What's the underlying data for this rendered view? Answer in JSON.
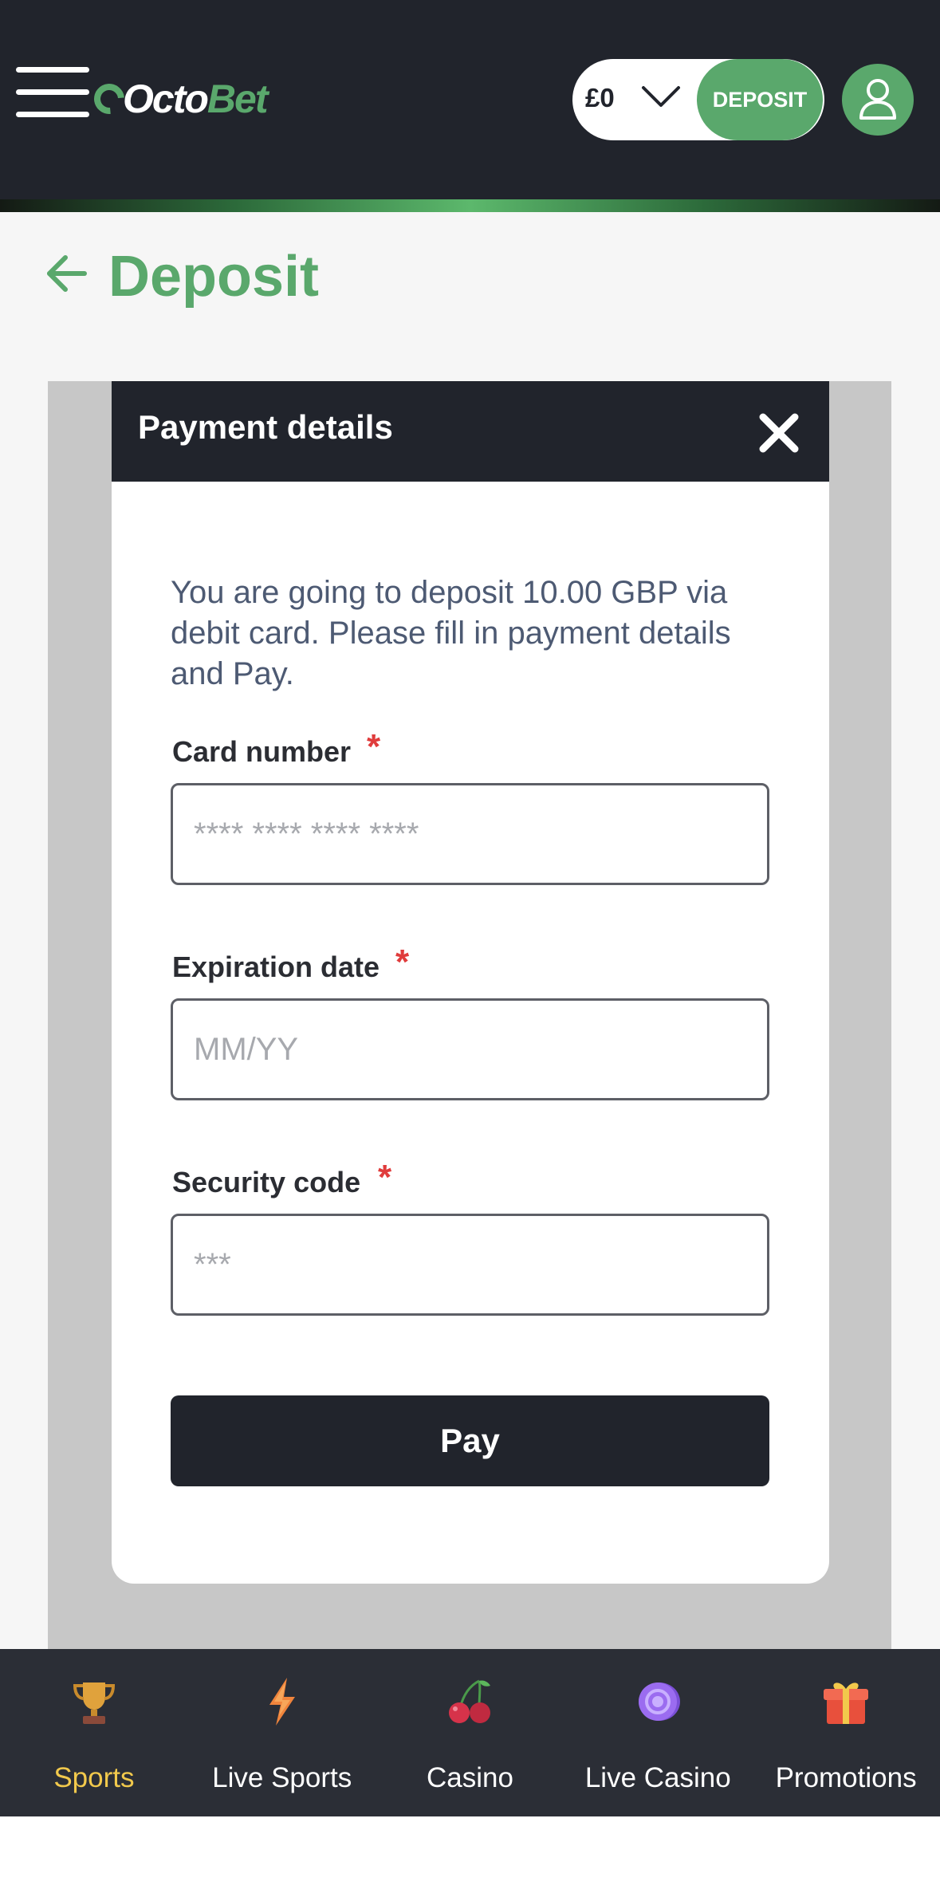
{
  "header": {
    "logo_prefix": "Octo",
    "logo_suffix": "Bet",
    "balance": "£0",
    "deposit_label": "DEPOSIT"
  },
  "page": {
    "title": "Deposit"
  },
  "modal": {
    "title": "Payment details",
    "intro": "You are going to deposit 10.00 GBP via debit card. Please fill in payment details and Pay.",
    "fields": {
      "card_number": {
        "label": "Card number",
        "required_mark": "*",
        "placeholder": "**** **** **** ****",
        "value": ""
      },
      "expiration_date": {
        "label": "Expiration date",
        "required_mark": "*",
        "placeholder": "MM/YY",
        "value": ""
      },
      "security_code": {
        "label": "Security code",
        "required_mark": "*",
        "placeholder": "***",
        "value": ""
      }
    },
    "pay_label": "Pay"
  },
  "bottom_nav": {
    "items": [
      {
        "label": "Sports",
        "icon": "trophy-icon",
        "active": true
      },
      {
        "label": "Live Sports",
        "icon": "lightning-icon",
        "active": false
      },
      {
        "label": "Casino",
        "icon": "cherries-icon",
        "active": false
      },
      {
        "label": "Live Casino",
        "icon": "chip-icon",
        "active": false
      },
      {
        "label": "Promotions",
        "icon": "gift-icon",
        "active": false
      }
    ]
  },
  "colors": {
    "brand_green": "#5aa86c",
    "header_dark": "#21242c",
    "active_nav": "#f2c94c",
    "required_red": "#e03c3c"
  }
}
